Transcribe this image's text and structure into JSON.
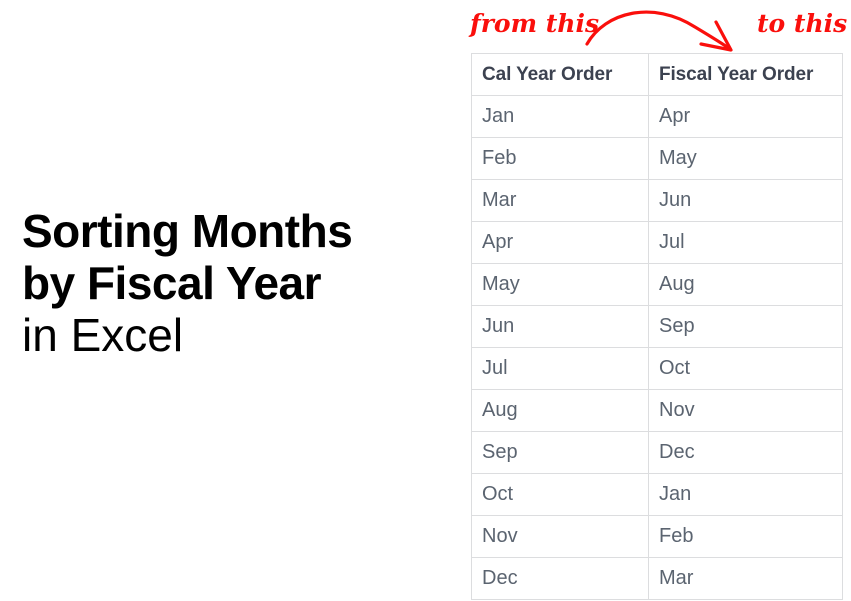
{
  "title": {
    "line1": "Sorting Months",
    "line2": "by Fiscal Year",
    "line3": "in Excel"
  },
  "annotations": {
    "from_label": "from this",
    "to_label": "to this",
    "arrow_icon": "curved-arrow-right-icon",
    "accent_color": "#fa0f0c"
  },
  "table": {
    "headers": [
      "Cal Year Order",
      "Fiscal Year Order"
    ],
    "rows": [
      [
        "Jan",
        "Apr"
      ],
      [
        "Feb",
        "May"
      ],
      [
        "Mar",
        "Jun"
      ],
      [
        "Apr",
        "Jul"
      ],
      [
        "May",
        "Aug"
      ],
      [
        "Jun",
        "Sep"
      ],
      [
        "Jul",
        "Oct"
      ],
      [
        "Aug",
        "Nov"
      ],
      [
        "Sep",
        "Dec"
      ],
      [
        "Oct",
        "Jan"
      ],
      [
        "Nov",
        "Feb"
      ],
      [
        "Dec",
        "Mar"
      ]
    ],
    "border_color": "#dcdddf",
    "header_text_color": "#3c4250",
    "cell_text_color": "#5b6470"
  }
}
